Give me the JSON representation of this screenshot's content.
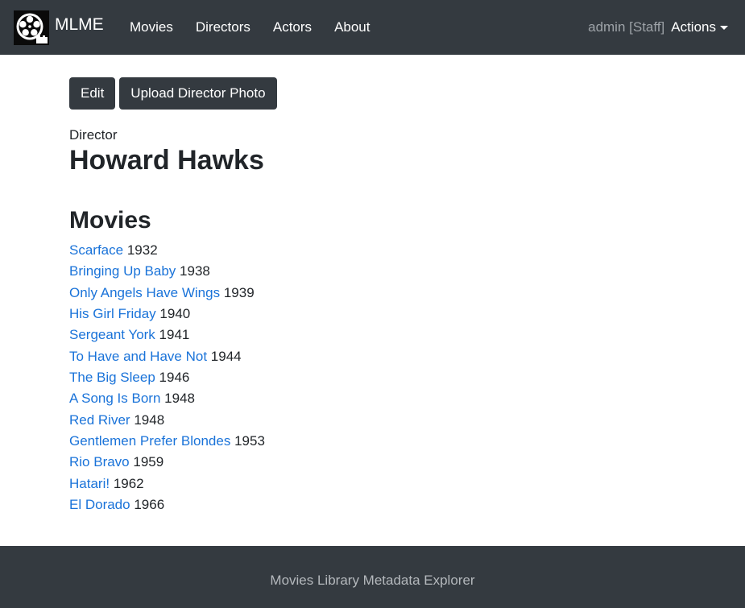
{
  "navbar": {
    "brand": "MLME",
    "links": [
      "Movies",
      "Directors",
      "Actors",
      "About"
    ],
    "user": "admin [Staff]",
    "actions_label": "Actions"
  },
  "toolbar": {
    "edit_label": "Edit",
    "upload_label": "Upload Director Photo"
  },
  "director": {
    "kicker": "Director",
    "name": "Howard Hawks"
  },
  "movies": {
    "heading": "Movies",
    "items": [
      {
        "title": "Scarface",
        "year": "1932"
      },
      {
        "title": "Bringing Up Baby",
        "year": "1938"
      },
      {
        "title": "Only Angels Have Wings",
        "year": "1939"
      },
      {
        "title": "His Girl Friday",
        "year": "1940"
      },
      {
        "title": "Sergeant York",
        "year": "1941"
      },
      {
        "title": "To Have and Have Not",
        "year": "1944"
      },
      {
        "title": "The Big Sleep",
        "year": "1946"
      },
      {
        "title": "A Song Is Born",
        "year": "1948"
      },
      {
        "title": "Red River",
        "year": "1948"
      },
      {
        "title": "Gentlemen Prefer Blondes",
        "year": "1953"
      },
      {
        "title": "Rio Bravo",
        "year": "1959"
      },
      {
        "title": "Hatari!",
        "year": "1962"
      },
      {
        "title": "El Dorado",
        "year": "1966"
      }
    ]
  },
  "footer": {
    "text": "Movies Library Metadata Explorer"
  },
  "colors": {
    "navbar_bg": "#343a40",
    "link": "#1a73d9",
    "text": "#212529"
  },
  "icons": {
    "logo": "film-reel-icon",
    "actions_caret": "caret-down-icon"
  }
}
